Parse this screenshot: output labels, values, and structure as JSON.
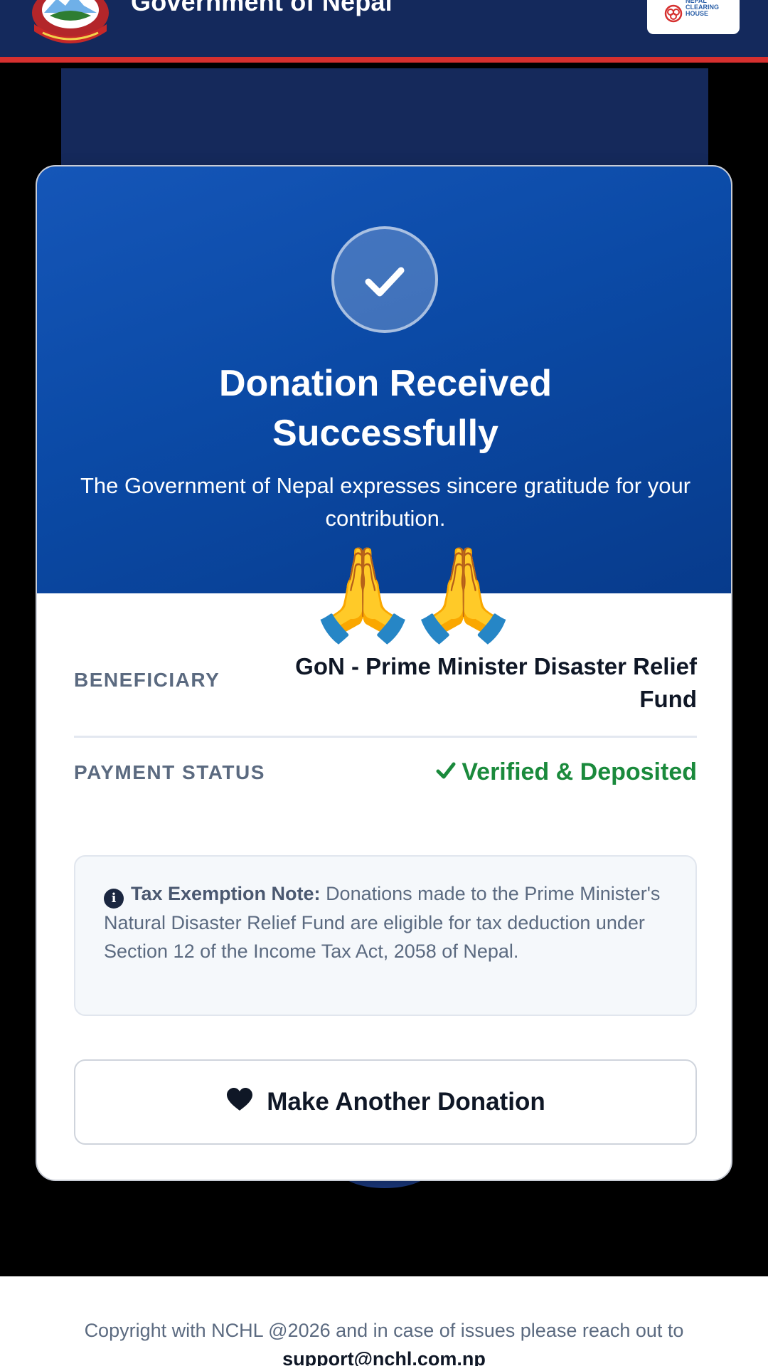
{
  "header": {
    "title": "Government of Nepal",
    "emblem_icon": "nepal-emblem-icon",
    "partner_logo": {
      "name": "NEPAL CLEARING HOUSE",
      "text": "NEPAL\nCLEARING\nHOUSE",
      "icon": "nchl-logo-icon"
    },
    "accent_color": "#d6302f",
    "bar_color": "#14295c"
  },
  "hero": {
    "check_icon": "check-circle-icon",
    "title": "Donation Received Successfully",
    "subtitle": "The Government of Nepal expresses sincere gratitude for your contribution.",
    "emoji": "🙏🙏"
  },
  "details": {
    "beneficiary_label": "BENEFICIARY",
    "beneficiary_value": "GoN - Prime Minister Disaster Relief Fund",
    "status_label": "PAYMENT STATUS",
    "status_value": "Verified & Deposited",
    "status_icon": "checkmark-icon",
    "status_color": "#1a8a3c"
  },
  "note": {
    "icon": "info-icon",
    "icon_glyph": "i",
    "heading": "Tax Exemption Note:",
    "body": "Donations made to the Prime Minister's Natural Disaster Relief Fund are eligible for tax deduction under Section 12 of the Income Tax Act, 2058 of Nepal."
  },
  "actions": {
    "donate_again_label": "Make Another Donation",
    "donate_again_icon": "heart-icon"
  },
  "footer": {
    "text": "Copyright with NCHL @2026 and in case of issues please reach out to",
    "email": "support@nchl.com.np"
  }
}
